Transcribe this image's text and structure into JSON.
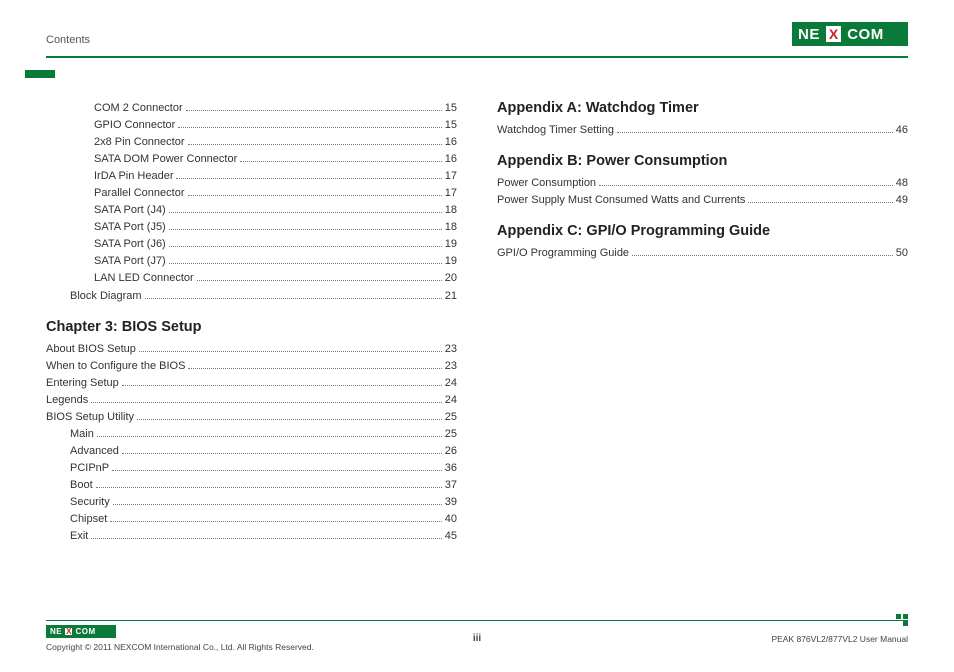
{
  "header": {
    "section_label": "Contents",
    "logo": {
      "left": "NE",
      "mid": "X",
      "right": "COM"
    }
  },
  "left_column": {
    "pre_items": [
      {
        "label": "COM 2 Connector",
        "page": "15",
        "indent": 2
      },
      {
        "label": "GPIO Connector",
        "page": "15",
        "indent": 2
      },
      {
        "label": "2x8 Pin Connector",
        "page": "16",
        "indent": 2
      },
      {
        "label": "SATA DOM Power Connector",
        "page": "16",
        "indent": 2
      },
      {
        "label": "IrDA Pin Header",
        "page": "17",
        "indent": 2
      },
      {
        "label": "Parallel Connector",
        "page": "17",
        "indent": 2
      },
      {
        "label": "SATA Port (J4)",
        "page": "18",
        "indent": 2
      },
      {
        "label": "SATA Port (J5)",
        "page": "18",
        "indent": 2
      },
      {
        "label": "SATA Port (J6)",
        "page": "19",
        "indent": 2
      },
      {
        "label": "SATA Port (J7)",
        "page": "19",
        "indent": 2
      },
      {
        "label": "LAN LED Connector",
        "page": "20",
        "indent": 2
      },
      {
        "label": "Block Diagram",
        "page": "21",
        "indent": 1
      }
    ],
    "chapter_title": "Chapter 3: BIOS Setup",
    "chapter_items": [
      {
        "label": "About BIOS Setup",
        "page": "23",
        "indent": 0
      },
      {
        "label": "When to Configure the BIOS",
        "page": "23",
        "indent": 0
      },
      {
        "label": "Entering Setup",
        "page": "24",
        "indent": 0
      },
      {
        "label": "Legends",
        "page": "24",
        "indent": 0
      },
      {
        "label": "BIOS Setup Utility",
        "page": "25",
        "indent": 0
      },
      {
        "label": "Main",
        "page": "25",
        "indent": 1
      },
      {
        "label": "Advanced",
        "page": "26",
        "indent": 1
      },
      {
        "label": "PCIPnP",
        "page": "36",
        "indent": 1
      },
      {
        "label": "Boot",
        "page": "37",
        "indent": 1
      },
      {
        "label": "Security",
        "page": "39",
        "indent": 1
      },
      {
        "label": "Chipset",
        "page": "40",
        "indent": 1
      },
      {
        "label": "Exit",
        "page": "45",
        "indent": 1
      }
    ]
  },
  "right_column": {
    "sections": [
      {
        "title": "Appendix A: Watchdog Timer",
        "items": [
          {
            "label": "Watchdog Timer Setting",
            "page": "46",
            "indent": 0
          }
        ]
      },
      {
        "title": "Appendix B: Power Consumption",
        "items": [
          {
            "label": "Power Consumption",
            "page": "48",
            "indent": 0
          },
          {
            "label": "Power Supply Must Consumed Watts and Currents",
            "page": "49",
            "indent": 0
          }
        ]
      },
      {
        "title": "Appendix C: GPI/O Programming Guide",
        "items": [
          {
            "label": "GPI/O Programming Guide",
            "page": "50",
            "indent": 0
          }
        ]
      }
    ]
  },
  "footer": {
    "logo": {
      "left": "NE",
      "mid": "X",
      "right": "COM"
    },
    "copyright": "Copyright © 2011 NEXCOM International Co., Ltd. All Rights Reserved.",
    "page_number": "iii",
    "doc_title": "PEAK 876VL2/877VL2 User Manual"
  }
}
